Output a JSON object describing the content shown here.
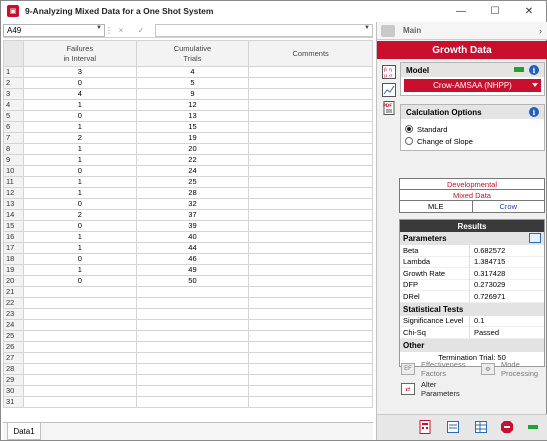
{
  "window": {
    "title": "9-Analyzing Mixed Data for a One Shot System",
    "minimize": "—",
    "maximize": "☐",
    "close": "✕"
  },
  "formula_bar": {
    "cell_ref": "A49",
    "cancel": "×",
    "confirm": "✓",
    "value": ""
  },
  "grid": {
    "headers": [
      "Failures\nin Interval",
      "Cumulative\nTrials",
      "Comments"
    ],
    "rows": [
      [
        "1",
        "3",
        "4",
        ""
      ],
      [
        "2",
        "0",
        "5",
        ""
      ],
      [
        "3",
        "4",
        "9",
        ""
      ],
      [
        "4",
        "1",
        "12",
        ""
      ],
      [
        "5",
        "0",
        "13",
        ""
      ],
      [
        "6",
        "1",
        "15",
        ""
      ],
      [
        "7",
        "2",
        "19",
        ""
      ],
      [
        "8",
        "1",
        "20",
        ""
      ],
      [
        "9",
        "1",
        "22",
        ""
      ],
      [
        "10",
        "0",
        "24",
        ""
      ],
      [
        "11",
        "1",
        "25",
        ""
      ],
      [
        "12",
        "1",
        "28",
        ""
      ],
      [
        "13",
        "0",
        "32",
        ""
      ],
      [
        "14",
        "2",
        "37",
        ""
      ],
      [
        "15",
        "0",
        "39",
        ""
      ],
      [
        "16",
        "1",
        "40",
        ""
      ],
      [
        "17",
        "1",
        "44",
        ""
      ],
      [
        "18",
        "0",
        "46",
        ""
      ],
      [
        "19",
        "1",
        "49",
        ""
      ],
      [
        "20",
        "0",
        "50",
        ""
      ],
      [
        "21",
        "",
        "",
        ""
      ],
      [
        "22",
        "",
        "",
        ""
      ],
      [
        "23",
        "",
        "",
        ""
      ],
      [
        "24",
        "",
        "",
        ""
      ],
      [
        "25",
        "",
        "",
        ""
      ],
      [
        "26",
        "",
        "",
        ""
      ],
      [
        "27",
        "",
        "",
        ""
      ],
      [
        "28",
        "",
        "",
        ""
      ],
      [
        "29",
        "",
        "",
        ""
      ],
      [
        "30",
        "",
        "",
        ""
      ],
      [
        "31",
        "",
        "",
        ""
      ]
    ]
  },
  "sheet_tabs": [
    "Data1"
  ],
  "panel": {
    "main_label": "Main",
    "header": "Growth Data",
    "model_title": "Model",
    "model_value": "Crow-AMSAA (NHPP)",
    "calc_title": "Calculation Options",
    "calc_options": [
      "Standard",
      "Change of Slope"
    ],
    "calc_selected": "Standard",
    "status": {
      "developmental": "Developmental",
      "data_type": "Mixed Data",
      "method": "MLE",
      "model": "Crow"
    },
    "results": {
      "title": "Results",
      "parameters_title": "Parameters",
      "parameters": [
        {
          "k": "Beta",
          "v": "0.682572"
        },
        {
          "k": "Lambda",
          "v": "1.384715"
        },
        {
          "k": "Growth Rate",
          "v": "0.317428"
        },
        {
          "k": "DFP",
          "v": "0.273029"
        },
        {
          "k": "DRel",
          "v": "0.726971"
        }
      ],
      "stat_title": "Statistical Tests",
      "stats": [
        {
          "k": "Significance Level",
          "v": "0.1"
        },
        {
          "k": "Chi-Sq",
          "v": "Passed"
        }
      ],
      "other_title": "Other",
      "termination": "Termination Trial: 50"
    },
    "actions": {
      "effectiveness": "Effectiveness\nFactors",
      "mode": "Mode\nProcessing",
      "alter": "Alter\nParameters"
    },
    "colors": {
      "accent": "#c8102e",
      "info_blue": "#1f5fbf",
      "ok_green": "#1fa32e"
    }
  }
}
